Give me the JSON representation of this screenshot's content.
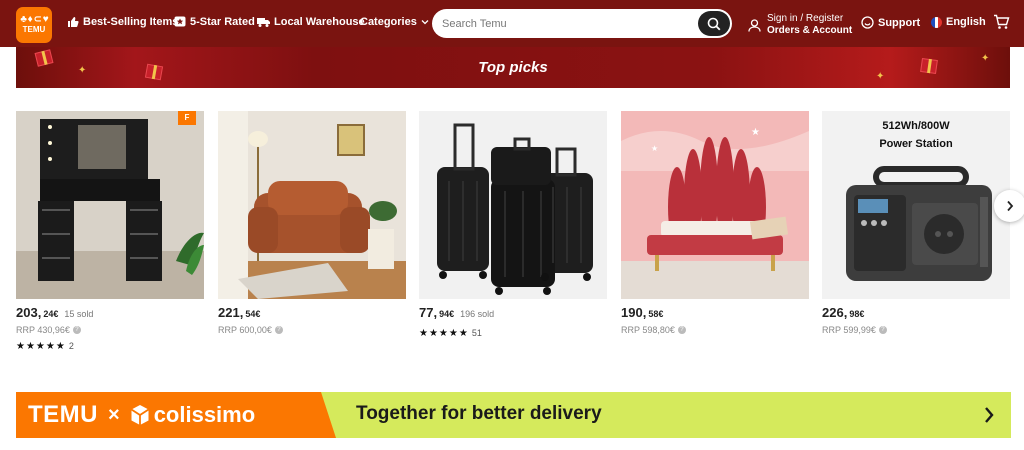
{
  "header": {
    "logo": {
      "glyphs": "♣ ♦ ⊂ ♥",
      "word": "TEMU"
    },
    "nav": [
      {
        "label": "Best-Selling Items",
        "icon": "thumbs-up-icon"
      },
      {
        "label": "5-Star Rated",
        "icon": "star-badge-icon"
      },
      {
        "label": "Local Warehouse",
        "icon": "truck-icon"
      },
      {
        "label": "Categories",
        "icon": "chevron-down-icon"
      }
    ],
    "search": {
      "placeholder": "Search Temu",
      "value": ""
    },
    "account": {
      "line1": "Sign in / Register",
      "line2": "Orders & Account"
    },
    "support": "Support",
    "language": "English",
    "colors": {
      "header_bg": "#7a1410",
      "accent": "#fb7701"
    }
  },
  "banner": {
    "title": "Top picks"
  },
  "products": [
    {
      "name": "black vanity dresser",
      "price_main": "203,",
      "price_sub": "24€",
      "sold": "15 sold",
      "rrp": "RRP 430,96€",
      "stars": "★★★★★",
      "reviews": "2",
      "badge": "F"
    },
    {
      "name": "terracotta armchair",
      "price_main": "221,",
      "price_sub": "54€",
      "sold": "",
      "rrp": "RRP 600,00€",
      "stars": "",
      "reviews": ""
    },
    {
      "name": "black luggage set",
      "price_main": "77,",
      "price_sub": "94€",
      "sold": "196 sold",
      "rrp": "",
      "stars": "★★★★★",
      "reviews": "51"
    },
    {
      "name": "red velvet bed",
      "price_main": "190,",
      "price_sub": "58€",
      "sold": "",
      "rrp": "RRP 598,80€",
      "stars": "",
      "reviews": ""
    },
    {
      "name": "power station",
      "price_main": "226,",
      "price_sub": "98€",
      "sold": "",
      "rrp": "RRP 599,99€",
      "stars": "",
      "reviews": "",
      "image_text_1": "512Wh/800W",
      "image_text_2": "Power Station"
    }
  ],
  "promo": {
    "left_brand": "TEMU",
    "x": "×",
    "partner": "colissimo",
    "text": "Together for better delivery"
  }
}
